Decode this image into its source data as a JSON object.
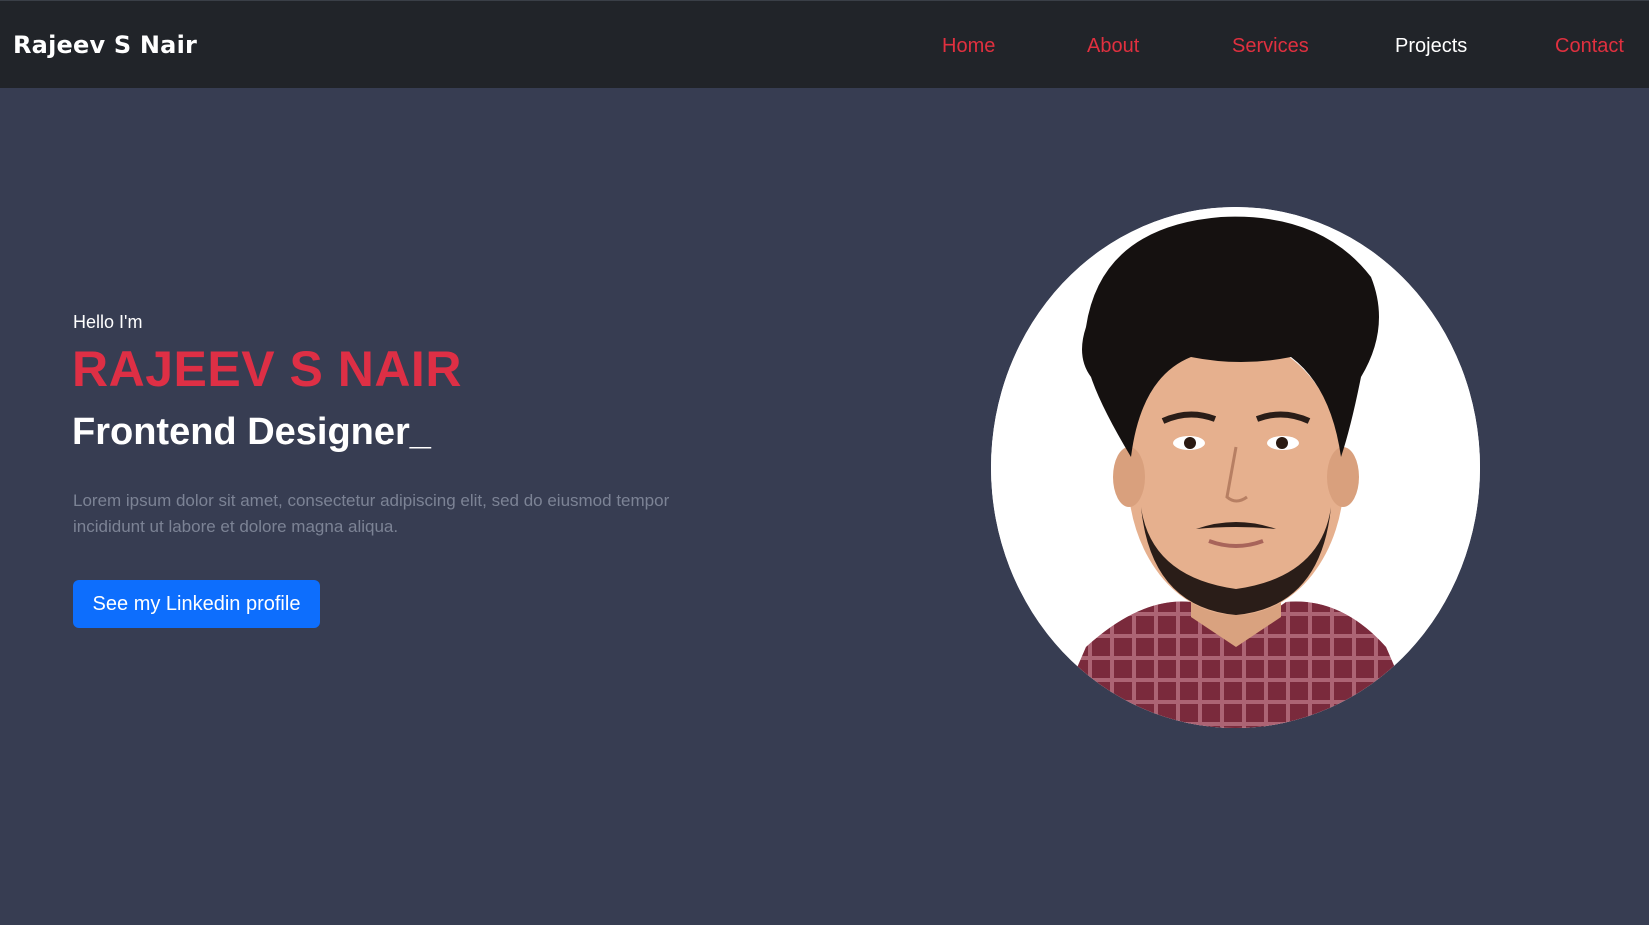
{
  "navbar": {
    "brand": "Rajeev S Nair",
    "links": [
      {
        "label": "Home"
      },
      {
        "label": "About"
      },
      {
        "label": "Services"
      },
      {
        "label": "Projects"
      },
      {
        "label": "Contact"
      }
    ],
    "active": "Projects"
  },
  "hero": {
    "greeting": "Hello I'm",
    "name": "RAJEEV S NAIR",
    "role": "Frontend Designer_",
    "description": "Lorem ipsum dolor sit amet, consectetur adipiscing elit, sed do eiusmod tempor incididunt ut labore et dolore magna aliqua.",
    "cta_label": "See my Linkedin profile"
  },
  "colors": {
    "navbar_bg": "#212429",
    "page_bg": "#373d52",
    "accent_red": "#de2f45",
    "button_blue": "#0d6efd"
  }
}
